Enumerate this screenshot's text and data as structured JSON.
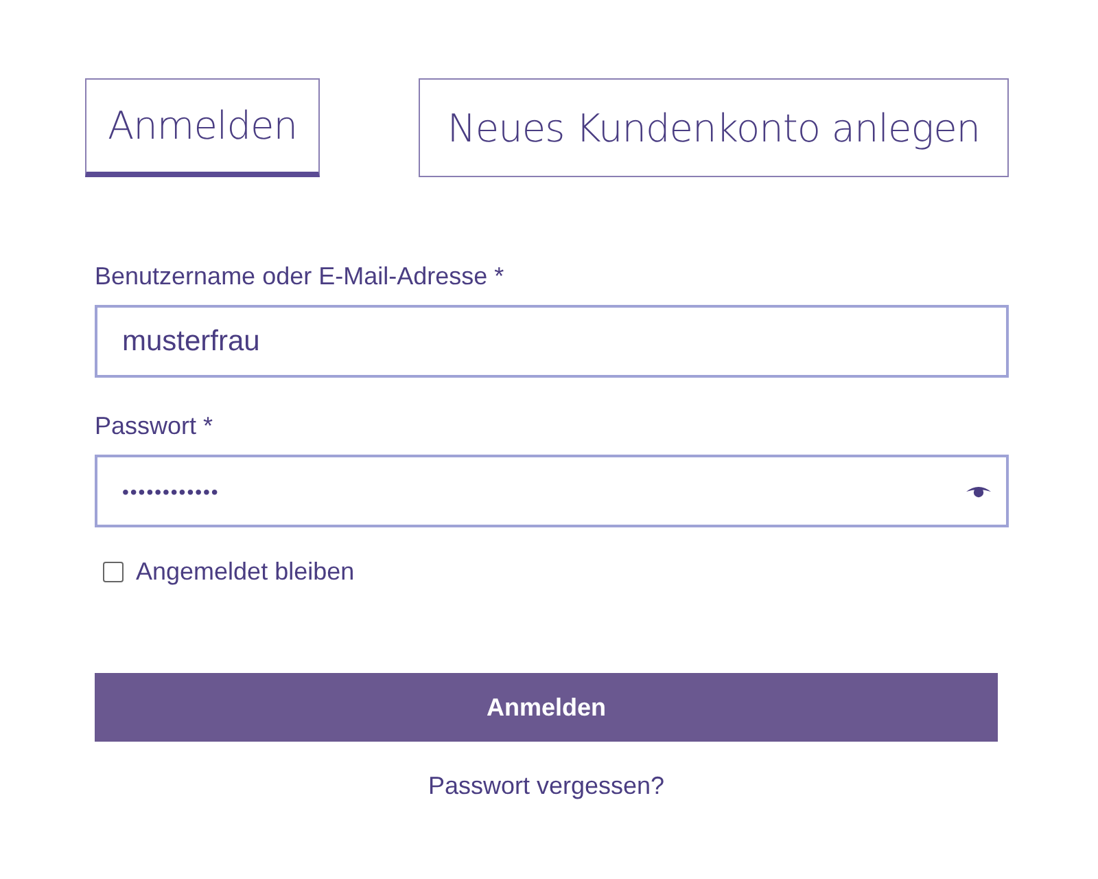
{
  "tabs": [
    {
      "label": "Anmelden",
      "selected": true
    },
    {
      "label": "Neues Kundenkonto anlegen",
      "selected": false
    }
  ],
  "fields": [
    {
      "label": "Benutzername oder E-Mail-Adresse *",
      "value": "musterfrau",
      "kind": "text"
    },
    {
      "label": "Passwort *",
      "value": "••••••••••••",
      "kind": "password"
    }
  ],
  "remember": {
    "label": "Angemeldet bleiben",
    "checked": false
  },
  "submit": "Anmelden",
  "forgot": "Passwort vergessen?"
}
